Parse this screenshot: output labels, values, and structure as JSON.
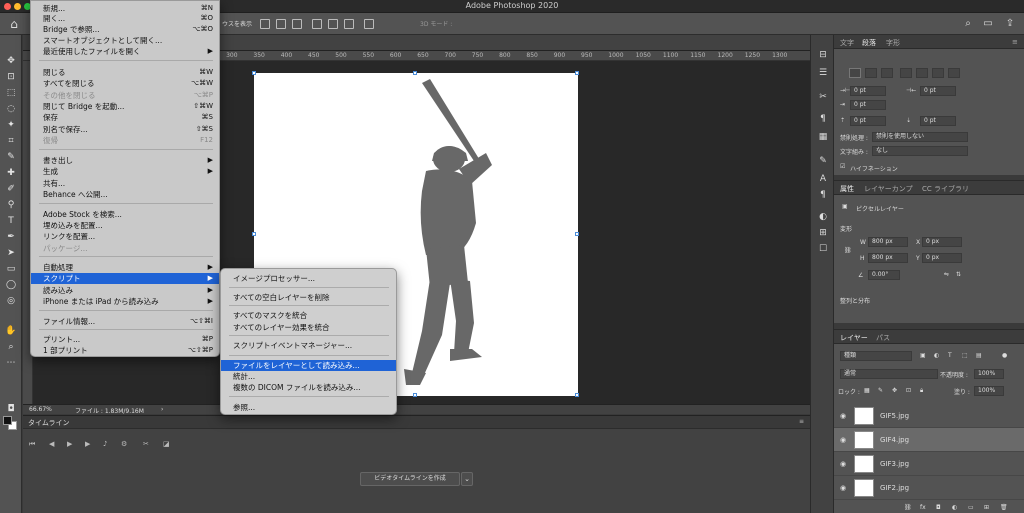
{
  "app": {
    "title": "Adobe Photoshop 2020"
  },
  "options_bar": {
    "show_transform_label": "ウスを表示",
    "mode_label": "3D モード :"
  },
  "file_menu": {
    "items": [
      {
        "label": "新規...",
        "shortcut": "⌘N"
      },
      {
        "label": "開く...",
        "shortcut": "⌘O"
      },
      {
        "label": "Bridge で参照...",
        "shortcut": "⌥⌘O"
      },
      {
        "label": "スマートオブジェクトとして開く...",
        "shortcut": ""
      },
      {
        "label": "最近使用したファイルを開く",
        "shortcut": "▶"
      },
      {
        "label": "閉じる",
        "shortcut": "⌘W"
      },
      {
        "label": "すべてを閉じる",
        "shortcut": "⌥⌘W"
      },
      {
        "label": "その他を閉じる",
        "shortcut": "⌥⌘P"
      },
      {
        "label": "閉じて Bridge を起動...",
        "shortcut": "⇧⌘W"
      },
      {
        "label": "保存",
        "shortcut": "⌘S"
      },
      {
        "label": "別名で保存...",
        "shortcut": "⇧⌘S"
      },
      {
        "label": "復帰",
        "shortcut": "F12"
      },
      {
        "label": "書き出し",
        "shortcut": "▶"
      },
      {
        "label": "生成",
        "shortcut": "▶"
      },
      {
        "label": "共有...",
        "shortcut": ""
      },
      {
        "label": "Behance へ公開...",
        "shortcut": ""
      },
      {
        "label": "Adobe Stock を検索...",
        "shortcut": ""
      },
      {
        "label": "埋め込みを配置...",
        "shortcut": ""
      },
      {
        "label": "リンクを配置...",
        "shortcut": ""
      },
      {
        "label": "パッケージ...",
        "shortcut": ""
      },
      {
        "label": "自動処理",
        "shortcut": "▶"
      },
      {
        "label": "スクリプト",
        "shortcut": "▶"
      },
      {
        "label": "読み込み",
        "shortcut": "▶"
      },
      {
        "label": "iPhone または iPad から読み込み",
        "shortcut": "▶"
      },
      {
        "label": "ファイル情報...",
        "shortcut": "⌥⇧⌘I"
      },
      {
        "label": "プリント...",
        "shortcut": "⌘P"
      },
      {
        "label": "1 部プリント",
        "shortcut": "⌥⇧⌘P"
      }
    ]
  },
  "script_submenu": {
    "items": [
      "イメージプロセッサー...",
      "すべての空白レイヤーを削除",
      "すべてのマスクを統合",
      "すべてのレイヤー効果を統合",
      "スクリプトイベントマネージャー...",
      "ファイルをレイヤーとして読み込み...",
      "統計...",
      "複数の DICOM ファイルを読み込み...",
      "参照..."
    ]
  },
  "rulers": {
    "h": [
      "50",
      "0",
      "50",
      "100",
      "150",
      "200",
      "250",
      "300",
      "350",
      "400",
      "450",
      "500",
      "550",
      "600",
      "650",
      "700",
      "750",
      "800",
      "850",
      "900",
      "950",
      "1000",
      "1050",
      "1100",
      "1150",
      "1200",
      "1250",
      "1300"
    ]
  },
  "status_bar": {
    "zoom": "66.67%",
    "file_info": "ファイル : 1.83M/9.16M"
  },
  "timeline": {
    "title": "タイムライン",
    "create_button": "ビデオタイムラインを作成"
  },
  "type_panel": {
    "tabs": [
      "文字",
      "段落",
      "字形"
    ],
    "indent_left": "0 pt",
    "indent_right": "0 pt",
    "indent_first": "0 pt",
    "space_before": "0 pt",
    "space_after": "0 pt",
    "kinsoku_label": "禁則処理 :",
    "kinsoku_value": "禁則を使用しない",
    "mojikumi_label": "文字組み :",
    "mojikumi_value": "なし",
    "hyphenation": "ハイフネーション"
  },
  "properties_panel": {
    "tabs": [
      "属性",
      "レイヤーカンプ",
      "CC ライブラリ"
    ],
    "layer_type": "ピクセルレイヤー",
    "transform_title": "変形",
    "w": "800 px",
    "h": "800 px",
    "x": "0 px",
    "y": "0 px",
    "angle": "0.00°",
    "align_title": "整列と分布"
  },
  "layers_panel": {
    "tabs": [
      "レイヤー",
      "パス"
    ],
    "filter_kind": "種類",
    "blend_mode": "通常",
    "opacity_label": "不透明度 :",
    "opacity": "100%",
    "lock_label": "ロック :",
    "fill_label": "塗り :",
    "fill": "100%",
    "layers": [
      "GIF5.jpg",
      "GIF4.jpg",
      "GIF3.jpg",
      "GIF2.jpg"
    ]
  }
}
